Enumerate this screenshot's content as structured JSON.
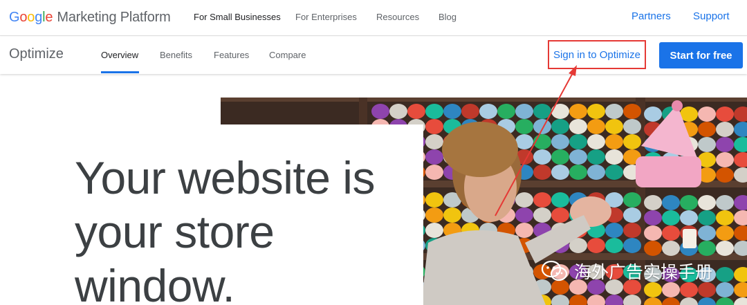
{
  "brand": {
    "google_letters": [
      {
        "char": "G",
        "color": "#4285F4"
      },
      {
        "char": "o",
        "color": "#EA4335"
      },
      {
        "char": "o",
        "color": "#FBBC05"
      },
      {
        "char": "g",
        "color": "#4285F4"
      },
      {
        "char": "l",
        "color": "#34A853"
      },
      {
        "char": "e",
        "color": "#EA4335"
      }
    ],
    "suffix": "Marketing Platform"
  },
  "top_nav": {
    "small_business": "For Small Businesses",
    "enterprises": "For Enterprises",
    "resources": "Resources",
    "blog": "Blog",
    "partners": "Partners",
    "support": "Support"
  },
  "sub_nav": {
    "product": "Optimize",
    "overview": "Overview",
    "benefits": "Benefits",
    "features": "Features",
    "compare": "Compare",
    "sign_in": "Sign in to Optimize",
    "start_free": "Start for free"
  },
  "hero": {
    "line1": "Your website is",
    "line2": "your store",
    "line3": "window."
  },
  "watermark": {
    "text": "海外广告实操手册",
    "icon": "wechat-icon"
  },
  "colors": {
    "accent": "#1a73e8",
    "highlight_box": "#e53935"
  }
}
